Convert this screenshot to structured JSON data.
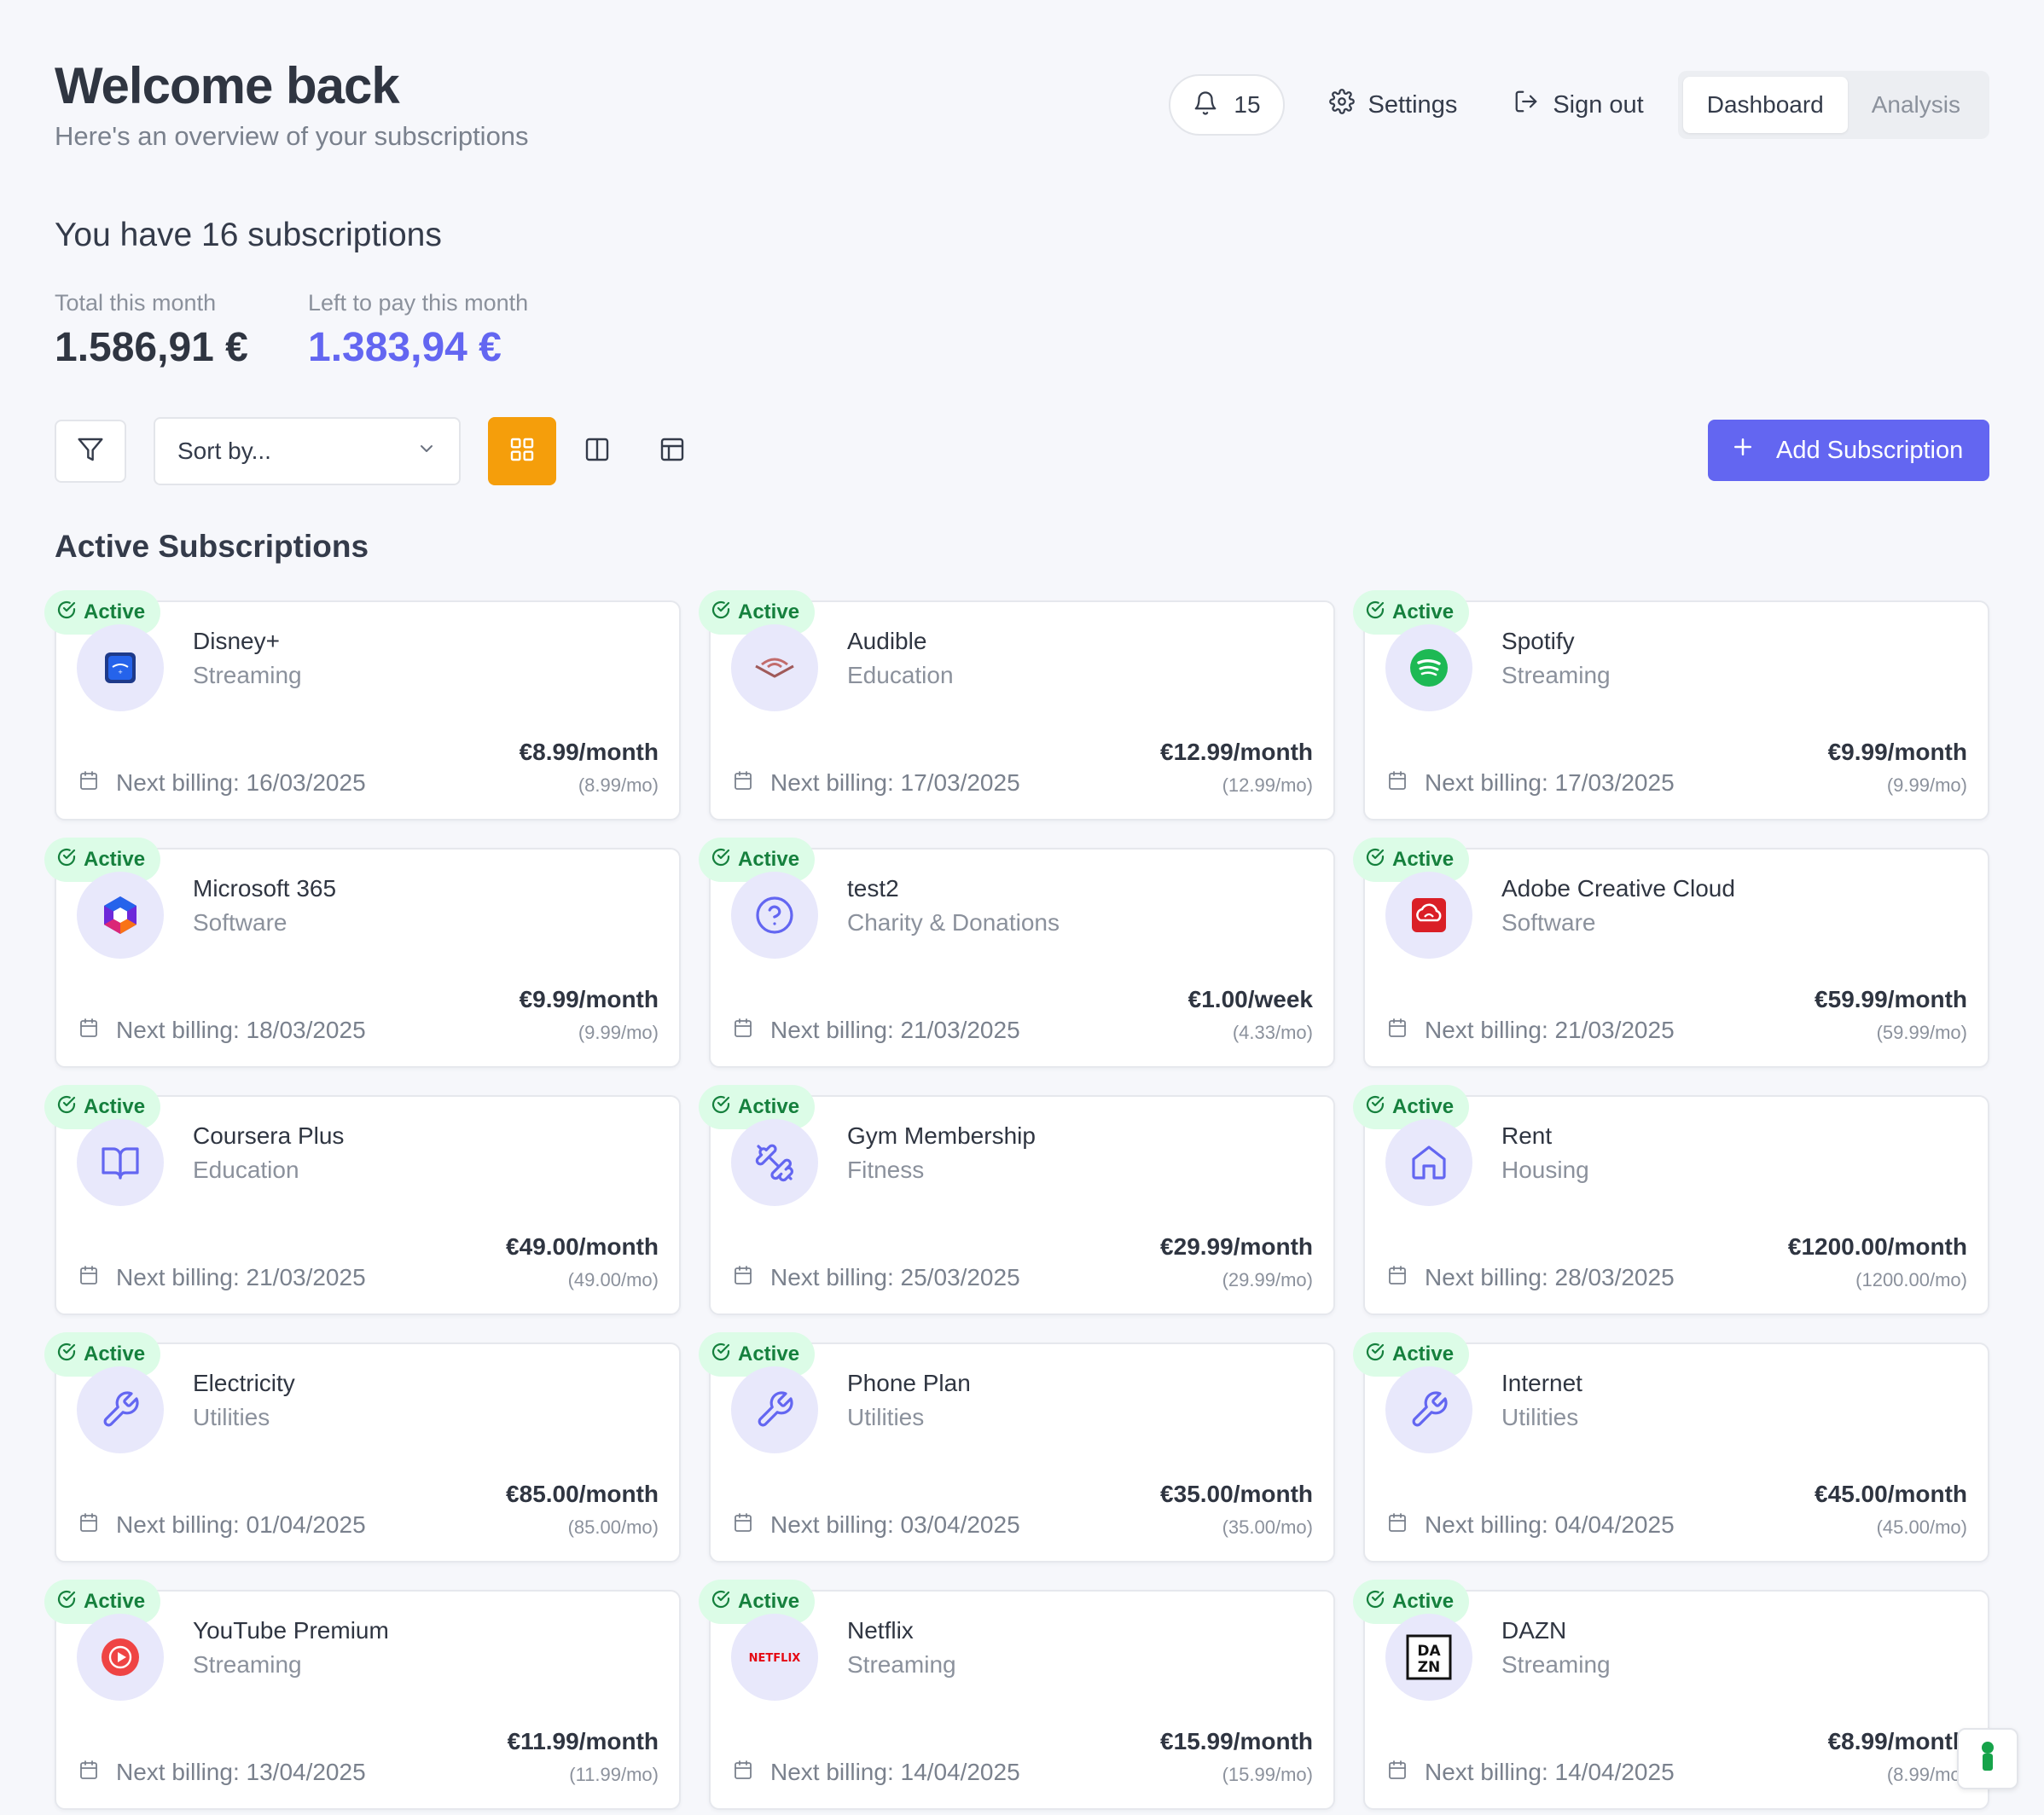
{
  "header": {
    "title": "Welcome back",
    "subtitle": "Here's an overview of your subscriptions",
    "notification_count": "15",
    "settings_label": "Settings",
    "signout_label": "Sign out",
    "tabs": [
      {
        "label": "Dashboard",
        "active": true
      },
      {
        "label": "Analysis",
        "active": false
      }
    ]
  },
  "summary": {
    "count_text": "You have 16 subscriptions",
    "total_label": "Total this month",
    "total_value": "1.586,91 €",
    "left_label": "Left to pay this month",
    "left_value": "1.383,94 €"
  },
  "toolbar": {
    "sort_placeholder": "Sort by...",
    "active_view": "grid",
    "add_label": "Add Subscription"
  },
  "section_title": "Active Subscriptions",
  "badge_label": "Active",
  "billing_prefix": "Next billing:",
  "subscriptions": [
    {
      "name": "Disney+",
      "category": "Streaming",
      "next_billing": "16/03/2025",
      "price": "€8.99/month",
      "monthly": "(8.99/mo)",
      "icon": "disney-plus-logo"
    },
    {
      "name": "Audible",
      "category": "Education",
      "next_billing": "17/03/2025",
      "price": "€12.99/month",
      "monthly": "(12.99/mo)",
      "icon": "audible-logo"
    },
    {
      "name": "Spotify",
      "category": "Streaming",
      "next_billing": "17/03/2025",
      "price": "€9.99/month",
      "monthly": "(9.99/mo)",
      "icon": "spotify-logo"
    },
    {
      "name": "Microsoft 365",
      "category": "Software",
      "next_billing": "18/03/2025",
      "price": "€9.99/month",
      "monthly": "(9.99/mo)",
      "icon": "microsoft-365-logo"
    },
    {
      "name": "test2",
      "category": "Charity & Donations",
      "next_billing": "21/03/2025",
      "price": "€1.00/week",
      "monthly": "(4.33/mo)",
      "icon": "question-icon"
    },
    {
      "name": "Adobe Creative Cloud",
      "category": "Software",
      "next_billing": "21/03/2025",
      "price": "€59.99/month",
      "monthly": "(59.99/mo)",
      "icon": "adobe-creative-cloud-logo"
    },
    {
      "name": "Coursera Plus",
      "category": "Education",
      "next_billing": "21/03/2025",
      "price": "€49.00/month",
      "monthly": "(49.00/mo)",
      "icon": "book-icon"
    },
    {
      "name": "Gym Membership",
      "category": "Fitness",
      "next_billing": "25/03/2025",
      "price": "€29.99/month",
      "monthly": "(29.99/mo)",
      "icon": "dumbbell-icon"
    },
    {
      "name": "Rent",
      "category": "Housing",
      "next_billing": "28/03/2025",
      "price": "€1200.00/month",
      "monthly": "(1200.00/mo)",
      "icon": "home-icon"
    },
    {
      "name": "Electricity",
      "category": "Utilities",
      "next_billing": "01/04/2025",
      "price": "€85.00/month",
      "monthly": "(85.00/mo)",
      "icon": "wrench-icon"
    },
    {
      "name": "Phone Plan",
      "category": "Utilities",
      "next_billing": "03/04/2025",
      "price": "€35.00/month",
      "monthly": "(35.00/mo)",
      "icon": "wrench-icon"
    },
    {
      "name": "Internet",
      "category": "Utilities",
      "next_billing": "04/04/2025",
      "price": "€45.00/month",
      "monthly": "(45.00/mo)",
      "icon": "wrench-icon"
    },
    {
      "name": "YouTube Premium",
      "category": "Streaming",
      "next_billing": "13/04/2025",
      "price": "€11.99/month",
      "monthly": "(11.99/mo)",
      "icon": "youtube-logo"
    },
    {
      "name": "Netflix",
      "category": "Streaming",
      "next_billing": "14/04/2025",
      "price": "€15.99/month",
      "monthly": "(15.99/mo)",
      "icon": "netflix-logo",
      "logo_text": "NETFLIX"
    },
    {
      "name": "DAZN",
      "category": "Streaming",
      "next_billing": "14/04/2025",
      "price": "€8.99/month",
      "monthly": "(8.99/mo)",
      "icon": "dazn-logo",
      "logo_text": "DAZN"
    }
  ],
  "colors": {
    "accent": "#6366f1",
    "active_view": "#f59e0b",
    "badge_bg": "#dcfce7",
    "badge_text": "#15803d",
    "icon_circle": "#e8e8fb"
  }
}
